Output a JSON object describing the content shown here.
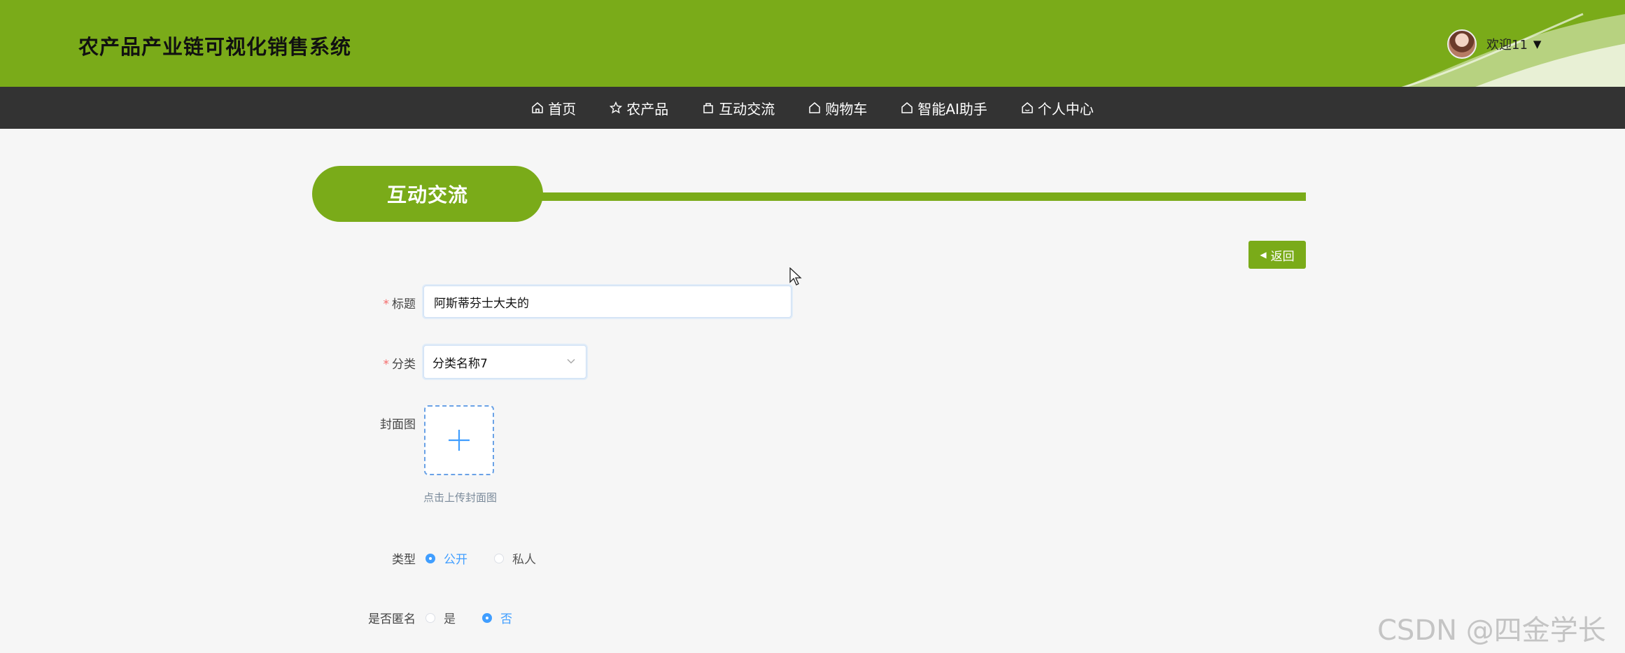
{
  "header": {
    "app_title": "农产品产业链可视化销售系统",
    "welcome": "欢迎11",
    "caret": "▼"
  },
  "nav": [
    {
      "label": "首页",
      "icon": "home-icon"
    },
    {
      "label": "农产品",
      "icon": "star-icon"
    },
    {
      "label": "互动交流",
      "icon": "bag-icon"
    },
    {
      "label": "购物车",
      "icon": "home-icon"
    },
    {
      "label": "智能AI助手",
      "icon": "home-icon"
    },
    {
      "label": "个人中心",
      "icon": "home-icon"
    }
  ],
  "section": {
    "title": "互动交流"
  },
  "back_button": {
    "label": "返回"
  },
  "form": {
    "title_label": "标题",
    "title_value": "阿斯蒂芬士大夫的",
    "category_label": "分类",
    "category_value": "分类名称7",
    "cover_label": "封面图",
    "cover_hint": "点击上传封面图",
    "type_label": "类型",
    "type_options": [
      "公开",
      "私人"
    ],
    "type_selected": "公开",
    "anon_label": "是否匿名",
    "anon_options": [
      "是",
      "否"
    ],
    "anon_selected": "否",
    "required_mark": "*"
  },
  "watermark": "CSDN @四金学长",
  "colors": {
    "brand_green": "#7aab19",
    "nav_bg": "#333333",
    "accent_blue": "#409eff"
  }
}
